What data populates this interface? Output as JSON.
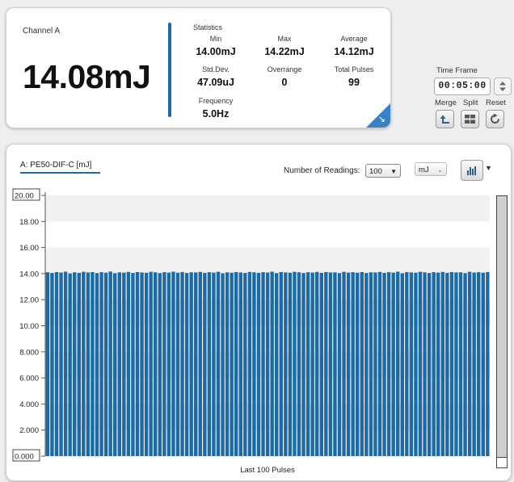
{
  "channel_panel": {
    "title": "Channel A",
    "main_value": "14.08mJ",
    "statistics": {
      "title": "Statistics",
      "min_label": "Min",
      "min_value": "14.00mJ",
      "max_label": "Max",
      "max_value": "14.22mJ",
      "avg_label": "Average",
      "avg_value": "14.12mJ",
      "std_label": "Std.Dev.",
      "std_value": "47.09uJ",
      "over_label": "Overrange",
      "over_value": "0",
      "pulses_label": "Total Pulses",
      "pulses_value": "99",
      "freq_label": "Frequency",
      "freq_value": "5.0Hz"
    }
  },
  "time_frame": {
    "label": "Time Frame",
    "value": "00:05:00",
    "merge_label": "Merge",
    "split_label": "Split",
    "reset_label": "Reset"
  },
  "chart_panel": {
    "tab_label": "A: PE50-DIF-C [mJ]",
    "readings_label": "Number of Readings:",
    "readings_value": "100",
    "unit_value": "mJ"
  },
  "colors": {
    "accent": "#1f6aa5",
    "bar": "#1f6aa5"
  },
  "icons": [
    "spinner-icon",
    "merge-icon",
    "split-icon",
    "reset-icon",
    "histogram-icon",
    "chevron-down-icon",
    "expand-corner-icon"
  ],
  "chart_data": {
    "type": "bar",
    "xlabel": "Last 100 Pulses",
    "ylabel": "",
    "ylim": [
      0,
      20
    ],
    "yticks": [
      "20.00",
      "18.00",
      "16.00",
      "14.00",
      "12.00",
      "10.00",
      "8.000",
      "6.000",
      "4.000",
      "2.000",
      "0.000"
    ],
    "values": [
      14.1,
      14.05,
      14.12,
      14.08,
      14.15,
      14.02,
      14.1,
      14.06,
      14.14,
      14.09,
      14.12,
      14.04,
      14.11,
      14.07,
      14.16,
      14.03,
      14.1,
      14.08,
      14.13,
      14.05,
      14.12,
      14.09,
      14.06,
      14.14,
      14.1,
      14.04,
      14.11,
      14.08,
      14.15,
      14.07,
      14.12,
      14.05,
      14.1,
      14.09,
      14.13,
      14.06,
      14.11,
      14.08,
      14.14,
      14.03,
      14.1,
      14.07,
      14.12,
      14.09,
      14.05,
      14.13,
      14.1,
      14.06,
      14.11,
      14.08,
      14.15,
      14.04,
      14.12,
      14.09,
      14.07,
      14.14,
      14.1,
      14.05,
      14.11,
      14.08,
      14.13,
      14.06,
      14.12,
      14.09,
      14.1,
      14.04,
      14.14,
      14.08,
      14.11,
      14.07,
      14.12,
      14.05,
      14.1,
      14.09,
      14.13,
      14.06,
      14.11,
      14.08,
      14.15,
      14.03,
      14.12,
      14.09,
      14.07,
      14.14,
      14.1,
      14.05,
      14.11,
      14.08,
      14.13,
      14.06,
      14.12,
      14.09,
      14.1,
      14.04,
      14.14,
      14.08,
      14.11,
      14.07,
      14.12
    ]
  }
}
